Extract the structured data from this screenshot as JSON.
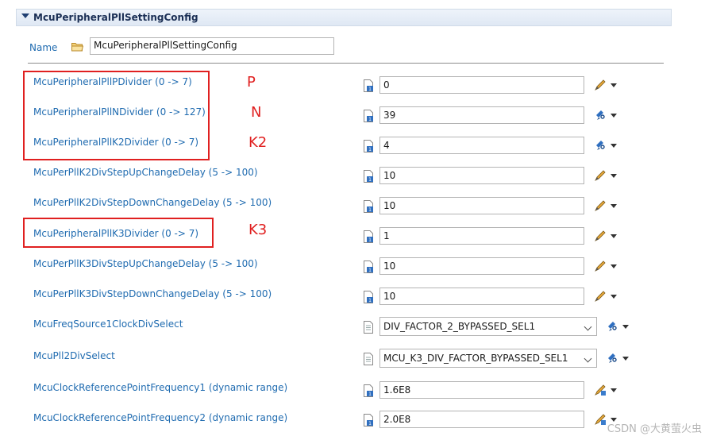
{
  "section": {
    "title": "McuPeripheralPllSettingConfig"
  },
  "name_row": {
    "label": "Name",
    "value": "McuPeripheralPllSettingConfig"
  },
  "rows": [
    {
      "label": "McuPeripheralPllPDivider (0 -> 7)",
      "value": "0",
      "kind": "input",
      "action": "pencil"
    },
    {
      "label": "McuPeripheralPllNDivider (0 -> 127)",
      "value": "39",
      "kind": "input",
      "action": "chain"
    },
    {
      "label": "McuPeripheralPllK2Divider (0 -> 7)",
      "value": "4",
      "kind": "input",
      "action": "chain"
    },
    {
      "label": "McuPerPllK2DivStepUpChangeDelay (5 -> 100)",
      "value": "10",
      "kind": "input",
      "action": "pencil"
    },
    {
      "label": "McuPerPllK2DivStepDownChangeDelay (5 -> 100)",
      "value": "10",
      "kind": "input",
      "action": "pencil"
    },
    {
      "label": "McuPeripheralPllK3Divider (0 -> 7)",
      "value": "1",
      "kind": "input",
      "action": "pencil"
    },
    {
      "label": "McuPerPllK3DivStepUpChangeDelay (5 -> 100)",
      "value": "10",
      "kind": "input",
      "action": "pencil"
    },
    {
      "label": "McuPerPllK3DivStepDownChangeDelay (5 -> 100)",
      "value": "10",
      "kind": "input",
      "action": "pencil"
    },
    {
      "label": "McuFreqSource1ClockDivSelect",
      "value": "DIV_FACTOR_2_BYPASSED_SEL1",
      "kind": "select",
      "action": "chain"
    },
    {
      "label": "McuPll2DivSelect",
      "value": "MCU_K3_DIV_FACTOR_BYPASSED_SEL1",
      "kind": "select",
      "action": "chain"
    },
    {
      "label": "McuClockReferencePointFrequency1 (dynamic range)",
      "value": "1.6E8",
      "kind": "input",
      "action": "pencil-calc"
    },
    {
      "label": "McuClockReferencePointFrequency2 (dynamic range)",
      "value": "2.0E8",
      "kind": "input",
      "action": "pencil-calc"
    }
  ],
  "annotations": {
    "p": "P",
    "n": "N",
    "k2": "K2",
    "k3": "K3"
  },
  "watermark": "CSDN @大黄萤火虫",
  "colors": {
    "label": "#1f6bb0",
    "annotation": "#e02020",
    "header_text": "#1b2f55"
  }
}
